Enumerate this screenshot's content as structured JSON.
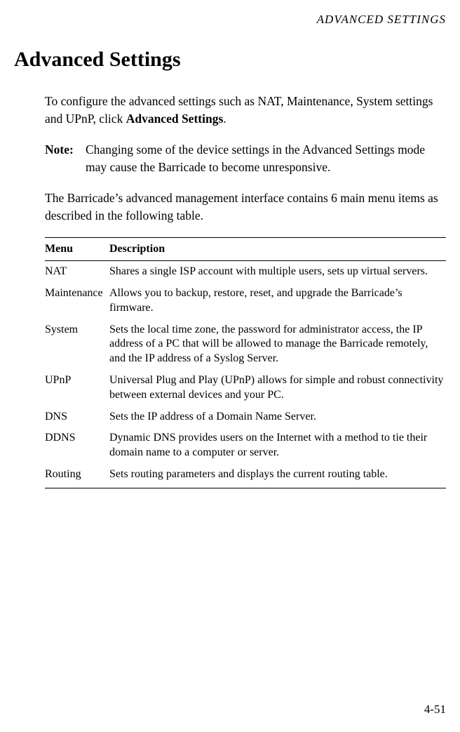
{
  "header": {
    "running_title": "ADVANCED SETTINGS"
  },
  "heading": "Advanced Settings",
  "intro_prefix": "To configure the advanced settings such as NAT, Maintenance, System settings and UPnP, click ",
  "intro_bold": "Advanced Settings",
  "intro_suffix": ".",
  "note": {
    "label": "Note:",
    "text": "Changing some of the device settings in the Advanced Settings mode may cause the Barricade to become unresponsive."
  },
  "para2": "The Barricade’s advanced management interface contains 6 main menu items as described in the following table.",
  "table": {
    "headers": {
      "menu": "Menu",
      "description": "Description"
    },
    "rows": [
      {
        "menu": "NAT",
        "description": "Shares a single ISP account with multiple users, sets up virtual servers."
      },
      {
        "menu": "Maintenance",
        "description": "Allows you to backup, restore, reset, and upgrade the Barricade’s firmware."
      },
      {
        "menu": "System",
        "description": "Sets the local time zone, the password for administrator access, the IP address of a PC that will be allowed to manage the Barricade remotely, and the IP address of a Syslog Server."
      },
      {
        "menu": "UPnP",
        "description": "Universal Plug and Play (UPnP) allows for simple and robust connectivity between external devices and your PC."
      },
      {
        "menu": "DNS",
        "description": "Sets the IP address of a Domain Name Server."
      },
      {
        "menu": "DDNS",
        "description": "Dynamic DNS provides users on the Internet with a method to tie their domain name to a computer or server."
      },
      {
        "menu": "Routing",
        "description": "Sets routing parameters and displays the current routing table."
      }
    ]
  },
  "page_number": "4-51"
}
